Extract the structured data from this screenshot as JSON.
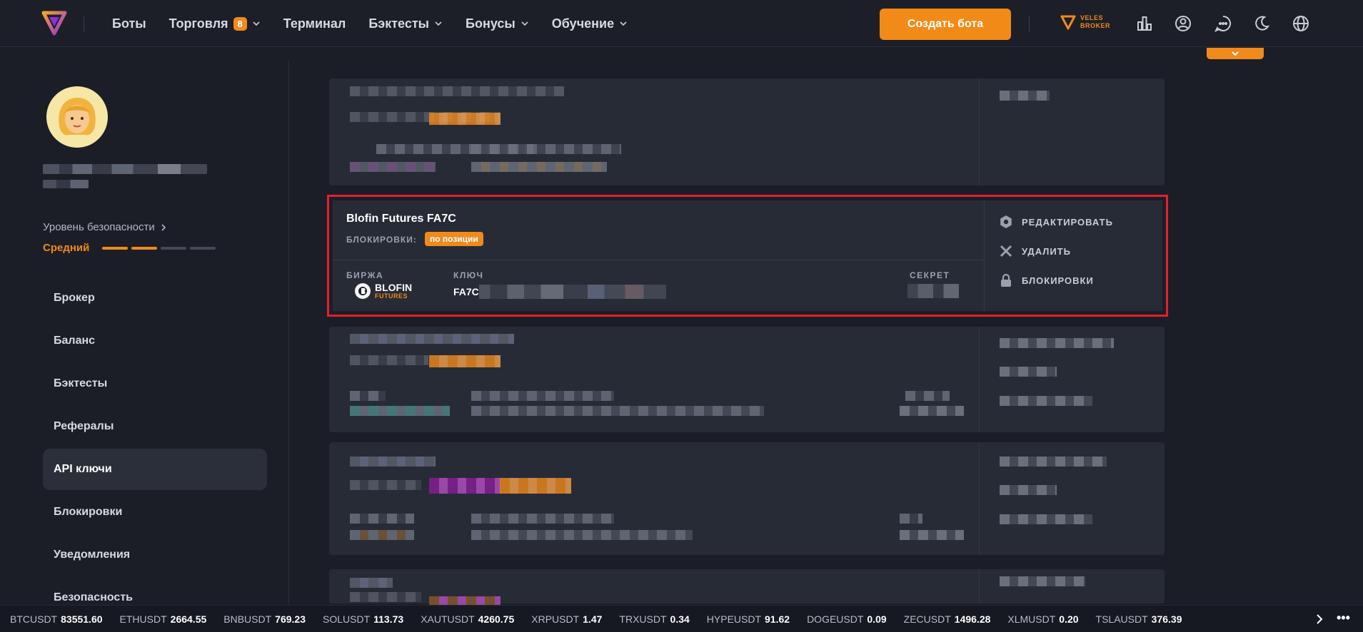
{
  "nav": {
    "items": [
      {
        "label": "Боты",
        "badge": null,
        "has_dropdown": false
      },
      {
        "label": "Торговля",
        "badge": "8",
        "has_dropdown": true
      },
      {
        "label": "Терминал",
        "badge": null,
        "has_dropdown": false
      },
      {
        "label": "Бэктесты",
        "badge": null,
        "has_dropdown": true
      },
      {
        "label": "Бонусы",
        "badge": null,
        "has_dropdown": true
      },
      {
        "label": "Обучение",
        "badge": null,
        "has_dropdown": true
      }
    ],
    "create_bot_label": "Создать бота",
    "broker_line1": "VELES",
    "broker_line2": "BROKER",
    "icons": [
      "stats-icon",
      "profile-icon",
      "chat-icon",
      "moon-icon",
      "globe-icon"
    ]
  },
  "sidebar": {
    "security_level_label": "Уровень безопасности",
    "security_level_value": "Средний",
    "security_level_filled": 2,
    "security_level_total": 4,
    "menu": [
      {
        "label": "Брокер",
        "active": false
      },
      {
        "label": "Баланс",
        "active": false
      },
      {
        "label": "Бэктесты",
        "active": false
      },
      {
        "label": "Рефералы",
        "active": false
      },
      {
        "label": "API ключи",
        "active": true
      },
      {
        "label": "Блокировки",
        "active": false
      },
      {
        "label": "Уведомления",
        "active": false
      },
      {
        "label": "Безопасность",
        "active": false
      }
    ]
  },
  "api_card": {
    "name": "Blofin Futures FA7C",
    "locks_label": "БЛОКИРОВКИ:",
    "locks_value": "по позиции",
    "exchange_label": "БИРЖА",
    "key_label": "КЛЮЧ",
    "secret_label": "СЕКРЕТ",
    "exchange_name": "BLOFIN",
    "exchange_sub": "FUTURES",
    "key_prefix": "FA7C",
    "actions": {
      "edit": "РЕДАКТИРОВАТЬ",
      "delete": "УДАЛИТЬ",
      "locks": "БЛОКИРОВКИ"
    }
  },
  "ticker": [
    {
      "symbol": "BTCUSDT",
      "value": "83551.60"
    },
    {
      "symbol": "ETHUSDT",
      "value": "2664.55"
    },
    {
      "symbol": "BNBUSDT",
      "value": "769.23"
    },
    {
      "symbol": "SOLUSDT",
      "value": "113.73"
    },
    {
      "symbol": "XAUTUSDT",
      "value": "4260.75"
    },
    {
      "symbol": "XRPUSDT",
      "value": "1.47"
    },
    {
      "symbol": "TRXUSDT",
      "value": "0.34"
    },
    {
      "symbol": "HYPEUSDT",
      "value": "91.62"
    },
    {
      "symbol": "DOGEUSDT",
      "value": "0.09"
    },
    {
      "symbol": "ZECUSDT",
      "value": "1496.28"
    },
    {
      "symbol": "XLMUSDT",
      "value": "0.20"
    },
    {
      "symbol": "TSLAUSDT",
      "value": "376.39"
    }
  ],
  "colors": {
    "accent": "#f08a1c",
    "highlight_border": "#e4202a",
    "background": "#1b1e27",
    "card": "#272b36"
  }
}
